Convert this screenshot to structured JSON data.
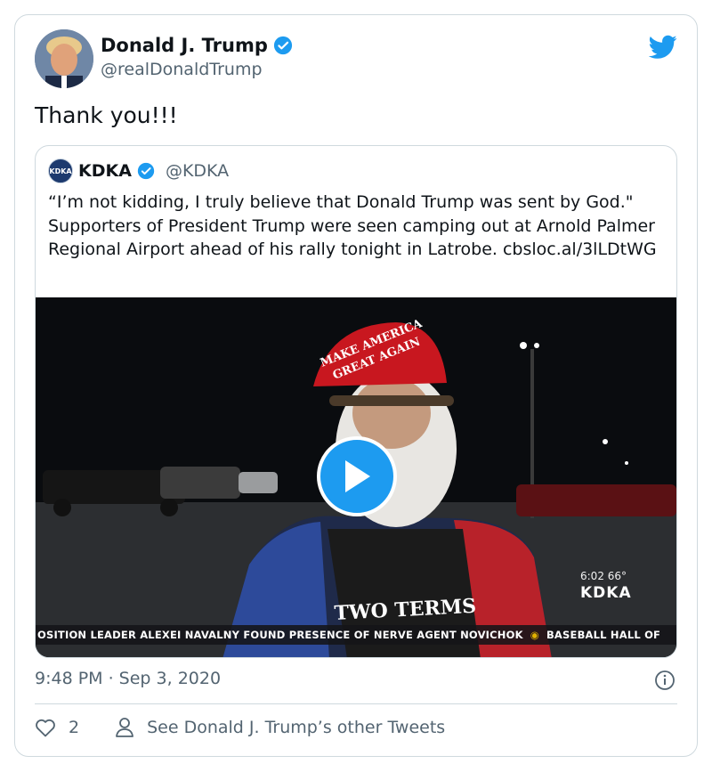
{
  "author": {
    "name": "Donald J. Trump",
    "handle": "@realDonaldTrump",
    "verified": true
  },
  "tweet": {
    "text": "Thank you!!!",
    "timestamp": "9:48 PM · Sep 3, 2020",
    "likes": "2",
    "other_tweets_label": "See Donald J. Trump’s other Tweets"
  },
  "quoted": {
    "logo_text": "KDKA",
    "name": "KDKA",
    "handle": "@KDKA",
    "verified": true,
    "text": "“I’m not kidding, I truly believe that Donald Trump was sent by God.\" Supporters of President Trump were seen camping out at Arnold Palmer Regional Airport ahead of his rally tonight in Latrobe. cbsloc.al/3lLDtWG",
    "video": {
      "hat_line1": "MAKE AMERICA",
      "hat_line2": "GREAT AGAIN",
      "shirt_text": "TWO TERMS",
      "ticker_part1": "OSITION LEADER ALEXEI NAVALNY FOUND PRESENCE OF NERVE AGENT NOVICHOK",
      "ticker_part2": "BASEBALL HALL OF",
      "stamp": "6:02  66°",
      "brand": "KDKA"
    }
  },
  "colors": {
    "accent": "#1d9bf0",
    "text": "#0f1419",
    "muted": "#536471",
    "border": "#cfd9de",
    "hat": "#c8171f"
  },
  "icons": [
    "verified-badge-icon",
    "twitter-bird-icon",
    "play-icon",
    "info-icon",
    "heart-icon",
    "person-icon"
  ]
}
